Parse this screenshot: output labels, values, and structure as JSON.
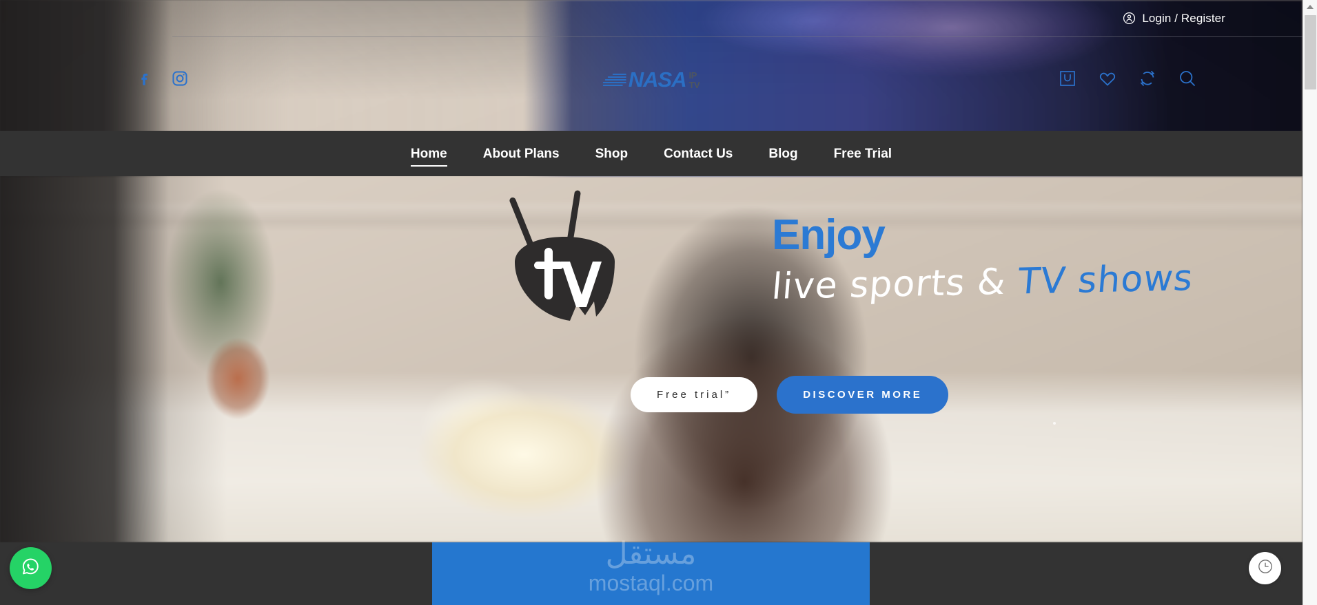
{
  "topbar": {
    "login_label": "Login / Register",
    "login_icon": "user-circle-icon"
  },
  "header": {
    "socials": [
      {
        "name": "facebook-icon",
        "label": "Facebook"
      },
      {
        "name": "instagram-icon",
        "label": "Instagram"
      }
    ],
    "logo": {
      "brand": "NASA",
      "sub_top": "IP",
      "sub_bottom": "TV",
      "color": "#2b6fc4"
    },
    "icons": [
      {
        "name": "cart-icon",
        "label": "Cart"
      },
      {
        "name": "heart-icon",
        "label": "Wishlist"
      },
      {
        "name": "compare-icon",
        "label": "Compare"
      },
      {
        "name": "search-icon",
        "label": "Search"
      }
    ]
  },
  "nav": {
    "items": [
      {
        "label": "Home",
        "active": true
      },
      {
        "label": "About Plans",
        "active": false
      },
      {
        "label": "Shop",
        "active": false
      },
      {
        "label": "Contact Us",
        "active": false
      },
      {
        "label": "Blog",
        "active": false
      },
      {
        "label": "Free Trial",
        "active": false
      }
    ]
  },
  "hero": {
    "tv_logo_text": "tv",
    "headline_line1": "Enjoy",
    "headline_line2_white": "live sports &",
    "headline_line2_blue": "TV shows",
    "primary_button": "Free trial”",
    "secondary_button": "DISCOVER MORE",
    "accent_color": "#2b7ad4",
    "button_color": "#2b72cc"
  },
  "footer": {
    "blue_color": "#2577cf",
    "strip_color": "#333333"
  },
  "watermark": {
    "arabic": "مستقل",
    "latin": "mostaql.com"
  },
  "floating": {
    "whatsapp": {
      "name": "whatsapp-icon",
      "color": "#25D366"
    },
    "history": {
      "name": "clock-history-icon",
      "color": "#ffffff"
    }
  }
}
